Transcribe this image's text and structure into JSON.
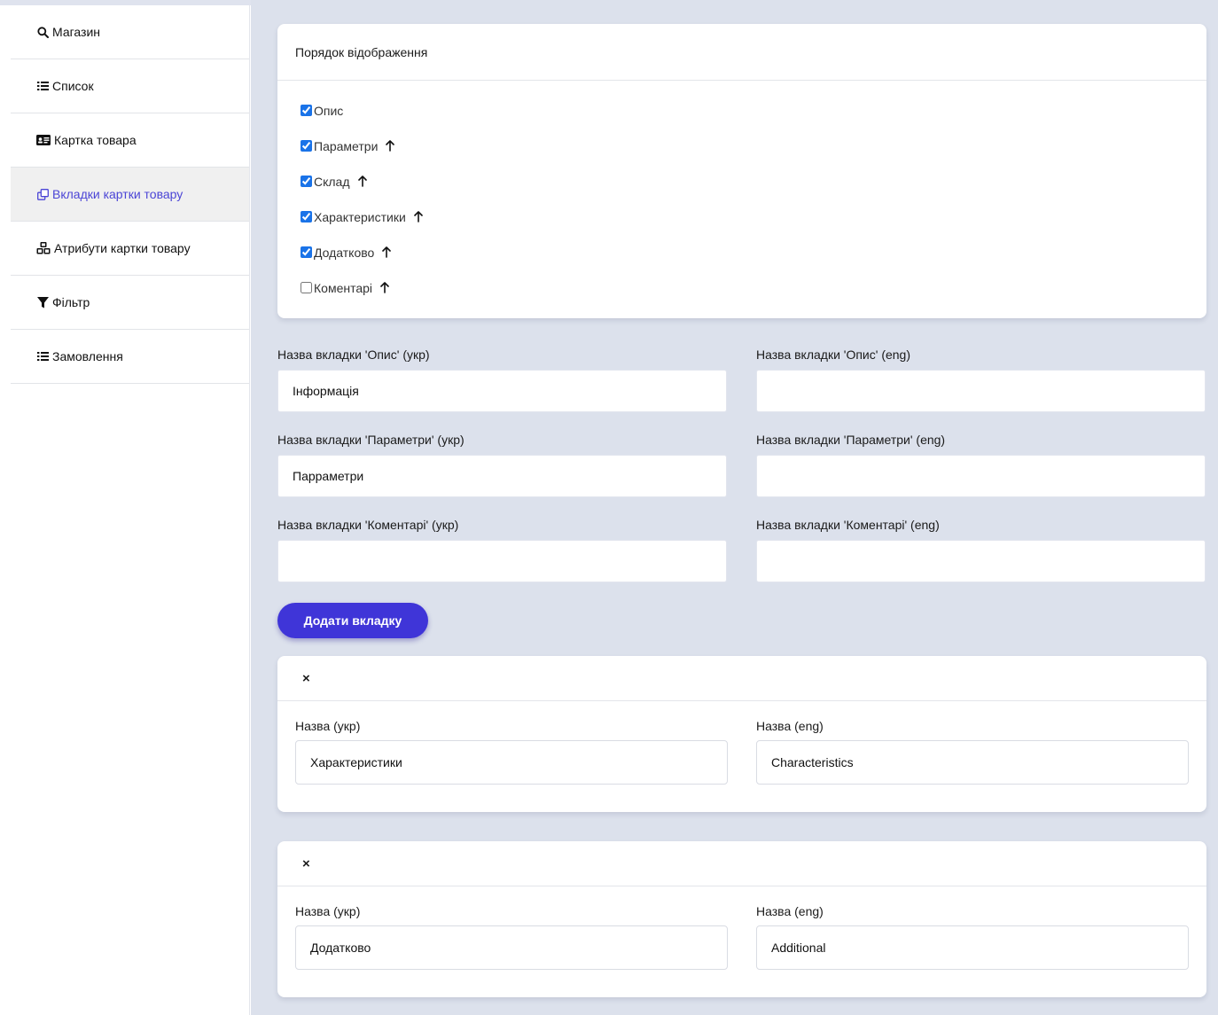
{
  "sidebar": {
    "items": [
      {
        "label": "Магазин",
        "icon": "search-icon"
      },
      {
        "label": "Список",
        "icon": "list-icon"
      },
      {
        "label": "Картка товара",
        "icon": "id-card-icon"
      },
      {
        "label": "Вкладки картки товару",
        "icon": "clone-icon",
        "active": true
      },
      {
        "label": "Атрибути картки товару",
        "icon": "cubes-icon"
      },
      {
        "label": "Фільтр",
        "icon": "filter-icon"
      },
      {
        "label": "Замовлення",
        "icon": "list-icon"
      }
    ]
  },
  "order": {
    "title": "Порядок відображення",
    "items": [
      {
        "label": "Опис",
        "checked": true,
        "arrow": false
      },
      {
        "label": "Параметри",
        "checked": true,
        "arrow": true
      },
      {
        "label": "Склад",
        "checked": true,
        "arrow": true
      },
      {
        "label": "Характеристики",
        "checked": true,
        "arrow": true
      },
      {
        "label": "Додатково",
        "checked": true,
        "arrow": true
      },
      {
        "label": "Коментарі",
        "checked": false,
        "arrow": true
      }
    ]
  },
  "fields": {
    "desc_ukr_label": "Назва вкладки 'Опис' (укр)",
    "desc_ukr_value": "Інформація",
    "desc_eng_label": "Назва вкладки 'Опис' (eng)",
    "desc_eng_value": "",
    "params_ukr_label": "Назва вкладки 'Параметри' (укр)",
    "params_ukr_value": "Парраметри",
    "params_eng_label": "Назва вкладки 'Параметри' (eng)",
    "params_eng_value": "",
    "comments_ukr_label": "Назва вкладки 'Коментарі' (укр)",
    "comments_ukr_value": "",
    "comments_eng_label": "Назва вкладки 'Коментарі' (eng)",
    "comments_eng_value": ""
  },
  "add_button_label": "Додати вкладку",
  "custom_tabs": [
    {
      "close": "×",
      "ukr_label": "Назва (укр)",
      "ukr_value": "Характеристики",
      "eng_label": "Назва (eng)",
      "eng_value": "Characteristics"
    },
    {
      "close": "×",
      "ukr_label": "Назва (укр)",
      "ukr_value": "Додатково",
      "eng_label": "Назва (eng)",
      "eng_value": "Additional"
    }
  ],
  "colors": {
    "accent": "#3f35d8",
    "active_link": "#4b45d6",
    "background": "#dce1ec"
  }
}
